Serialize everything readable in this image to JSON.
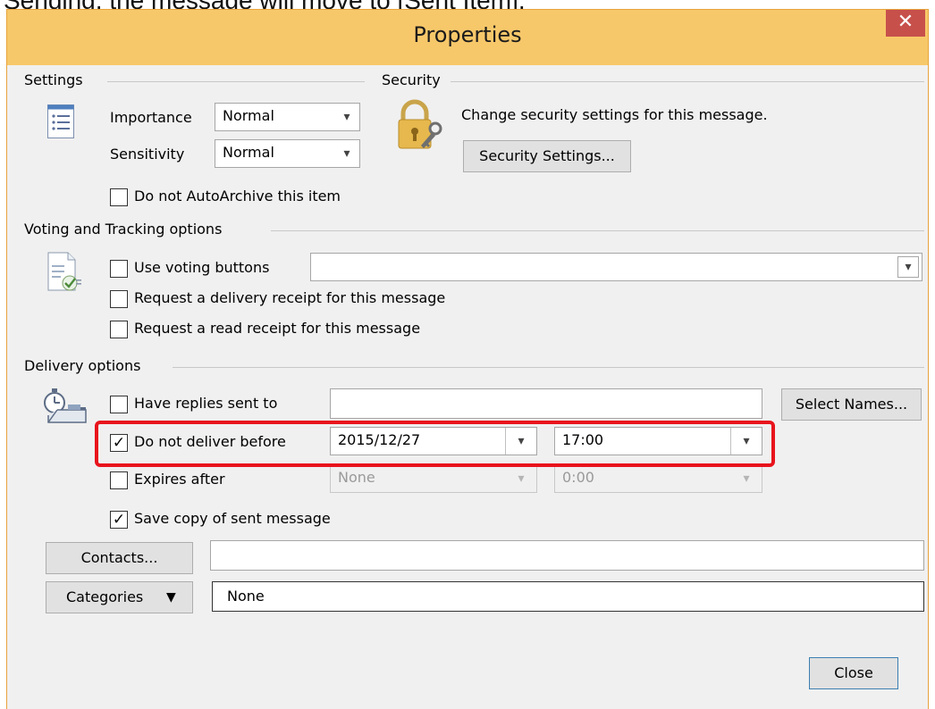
{
  "caption": "Sending, the message will move to [Sent Item].",
  "dialog": {
    "title": "Properties",
    "close_glyph": "✕"
  },
  "settings": {
    "group_label": "Settings",
    "importance_label": "Importance",
    "importance_value": "Normal",
    "sensitivity_label": "Sensitivity",
    "sensitivity_value": "Normal",
    "autoarchive_label": "Do not AutoArchive this item",
    "autoarchive_checked": false
  },
  "security": {
    "group_label": "Security",
    "description": "Change security settings for this message.",
    "button_label": "Security Settings..."
  },
  "voting": {
    "group_label": "Voting and Tracking options",
    "use_voting_label": "Use voting buttons",
    "use_voting_value": "",
    "delivery_receipt_label": "Request a delivery receipt for this message",
    "read_receipt_label": "Request a read receipt for this message"
  },
  "delivery": {
    "group_label": "Delivery options",
    "replies_label": "Have replies sent to",
    "replies_value": "",
    "select_names_label": "Select Names...",
    "do_not_deliver_label": "Do not deliver before",
    "do_not_deliver_checked": true,
    "do_not_deliver_date": "2015/12/27",
    "do_not_deliver_time": "17:00",
    "expires_label": "Expires after",
    "expires_checked": false,
    "expires_date": "None",
    "expires_time": "0:00",
    "save_copy_label": "Save copy of sent message",
    "save_copy_checked": true
  },
  "contacts": {
    "button_label": "Contacts...",
    "value": ""
  },
  "categories": {
    "button_label": "Categories",
    "value": "None"
  },
  "footer": {
    "close_label": "Close"
  },
  "icons": {
    "settings": "list-icon",
    "security": "lock-key-icon",
    "voting": "voting-document-icon",
    "delivery": "delivery-timer-icon",
    "dropdown": "chevron-down-icon"
  },
  "colors": {
    "titlebar": "#f7c86a",
    "close_button": "#c7504b",
    "highlight": "#e8141c"
  }
}
